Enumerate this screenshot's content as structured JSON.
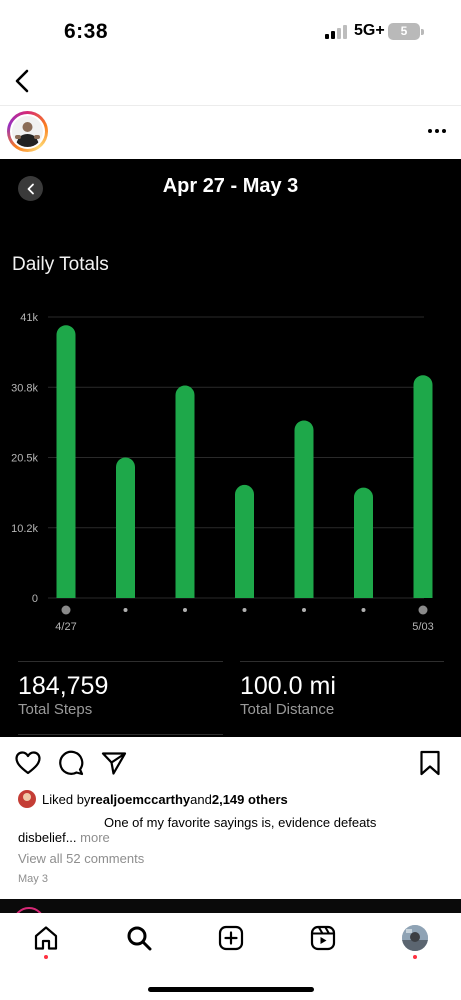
{
  "status_bar": {
    "time": "6:38",
    "network": "5G+",
    "battery": "5"
  },
  "nav": {
    "back_icon": "chevron-left-icon"
  },
  "post_header": {
    "avatar_icon": "user-avatar",
    "more_icon": "ellipsis-icon"
  },
  "post_image": {
    "date_range": "Apr 27 - May 3",
    "chart_title": "Daily Totals",
    "stats": [
      {
        "value": "184,759",
        "label": "Total Steps"
      },
      {
        "value": "100.0 mi",
        "label": "Total Distance"
      }
    ]
  },
  "chart_data": {
    "type": "bar",
    "title": "Daily Totals",
    "categories": [
      "4/27",
      "",
      "",
      "",
      "",
      "",
      "5/03"
    ],
    "values": [
      39800,
      20500,
      31000,
      16500,
      25900,
      16100,
      32500
    ],
    "ylim": [
      0,
      41000
    ],
    "yticks": [
      "0",
      "10.2k",
      "20.5k",
      "30.8k",
      "41k"
    ],
    "ytick_values": [
      0,
      10250,
      20500,
      30750,
      41000
    ],
    "bar_color": "#1ea84a",
    "grid": true
  },
  "actions": {
    "like_icon": "heart-icon",
    "comment_icon": "comment-icon",
    "share_icon": "send-icon",
    "save_icon": "bookmark-icon"
  },
  "likes": {
    "prefix": "Liked by ",
    "user": "realjoemccarthy",
    "conjunction": " and ",
    "others": "2,149 others"
  },
  "caption": {
    "line1": "One of my favorite sayings is, evidence defeats",
    "line2": "disbelief...",
    "more": " more"
  },
  "comments_link": "View all 52 comments",
  "post_date": "May 3",
  "tab_bar": {
    "home_icon": "home-icon",
    "search_icon": "search-icon",
    "create_icon": "plus-square-icon",
    "reels_icon": "reels-icon",
    "profile_icon": "profile-avatar"
  },
  "colors": {
    "accent_red": "#ff3040",
    "chart_green": "#1ea84a"
  }
}
